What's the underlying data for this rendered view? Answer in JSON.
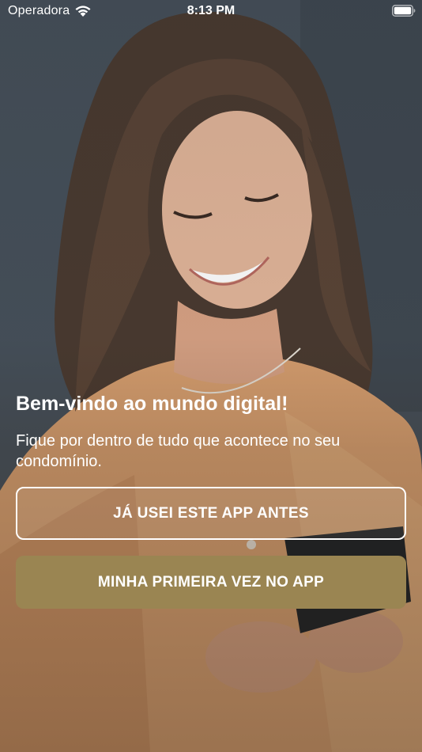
{
  "status_bar": {
    "carrier": "Operadora",
    "time": "8:13 PM",
    "icons": [
      "wifi-icon",
      "battery-icon"
    ]
  },
  "background": {
    "icon": "photo-woman-using-phone"
  },
  "welcome": {
    "title": "Bem-vindo ao mundo digital!",
    "subtitle": "Fique por dentro de tudo que acontece no seu condomínio."
  },
  "actions": {
    "returning_label": "JÁ USEI ESTE APP ANTES",
    "first_time_label": "MINHA PRIMEIRA VEZ NO APP"
  },
  "colors": {
    "primary_button": "#9a8552",
    "text": "#ffffff"
  }
}
